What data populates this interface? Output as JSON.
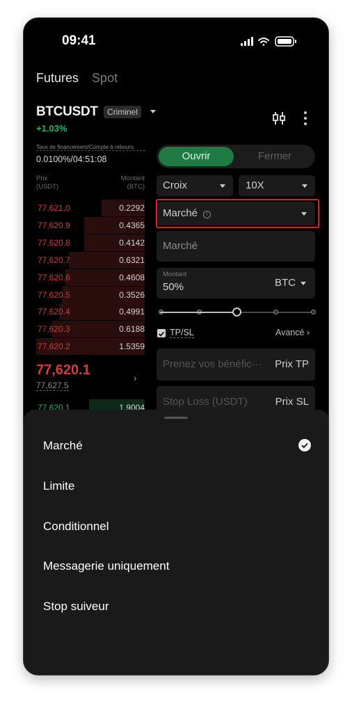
{
  "status": {
    "time": "09:41"
  },
  "tabs": [
    {
      "label": "Futures"
    },
    {
      "label": "Spot"
    }
  ],
  "symbol": {
    "name": "BTCUSDT",
    "badge": "Criminel",
    "change": "+1.03%"
  },
  "funding": {
    "label": "Taux de financement/Compte à rebours",
    "value": "0.0100%/04:51:08"
  },
  "orderbook": {
    "price_header": [
      "Prix",
      "(USDT)"
    ],
    "amount_header": [
      "Montant",
      "(BTC)"
    ],
    "asks": [
      {
        "price": "77,621.0",
        "amount": "0.2292",
        "depth": 0.4
      },
      {
        "price": "77,620.9",
        "amount": "0.4365",
        "depth": 0.56
      },
      {
        "price": "77,620.8",
        "amount": "0.4142",
        "depth": 0.56
      },
      {
        "price": "77,620.7",
        "amount": "0.6321",
        "depth": 0.7
      },
      {
        "price": "77,620.6",
        "amount": "0.4608",
        "depth": 0.73
      },
      {
        "price": "77,620.5",
        "amount": "0.3526",
        "depth": 0.76
      },
      {
        "price": "77,620.4",
        "amount": "0.4991",
        "depth": 0.79
      },
      {
        "price": "77,620.3",
        "amount": "0.6188",
        "depth": 0.85
      },
      {
        "price": "77,620.2",
        "amount": "1.5359",
        "depth": 1.0
      }
    ],
    "last_price": "77,620.1",
    "mark_price": "77,627.5",
    "bid": {
      "price": "77,620.1",
      "amount": "1.9004"
    }
  },
  "form": {
    "open_label": "Ouvrir",
    "close_label": "Fermer",
    "margin_mode": "Croix",
    "leverage": "10X",
    "order_type": "Marché",
    "price_field": "Marché",
    "amount_label": "Montant",
    "amount_value": "50%",
    "amount_unit": "BTC",
    "slider_value": 0.5,
    "tpsl_label": "TP/SL",
    "advanced_label": "Avancé",
    "tp_placeholder": "Prenez vos bénéfic···",
    "tp_suffix": "Prix TP",
    "sl_placeholder": "Stop Loss (USDT)",
    "sl_suffix": "Prix SL"
  },
  "sheet": {
    "options": [
      {
        "label": "Marché",
        "selected": true
      },
      {
        "label": "Limite",
        "selected": false
      },
      {
        "label": "Conditionnel",
        "selected": false
      },
      {
        "label": "Messagerie uniquement",
        "selected": false
      },
      {
        "label": "Stop suiveur",
        "selected": false
      }
    ]
  },
  "colors": {
    "ask": "#d33b3b",
    "bid": "#2db367",
    "accent": "#1f7a44",
    "highlight": "#e02020"
  }
}
